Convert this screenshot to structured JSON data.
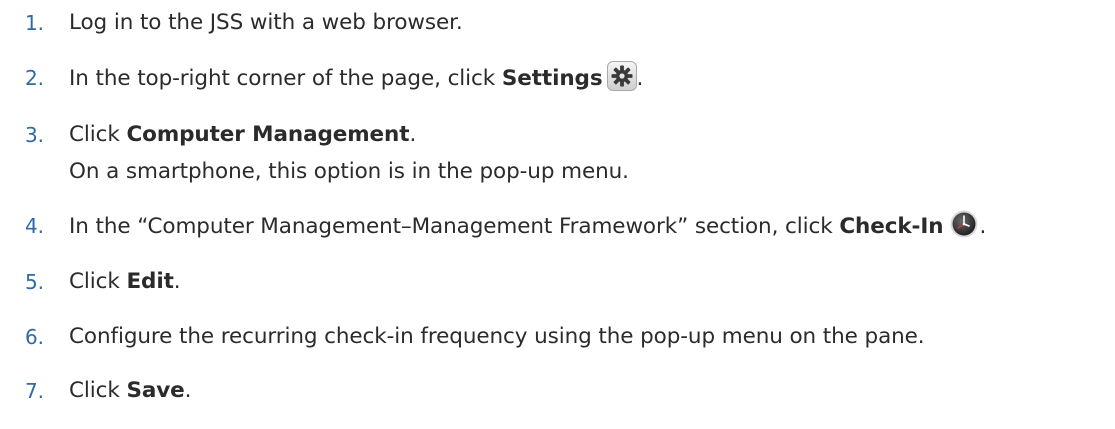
{
  "steps": [
    {
      "num": "1.",
      "parts": {
        "a": "Log in to the JSS with a web browser."
      }
    },
    {
      "num": "2.",
      "parts": {
        "a": "In the top-right corner of the page, click ",
        "b": "Settings",
        "after": "."
      }
    },
    {
      "num": "3.",
      "parts": {
        "a": "Click ",
        "b": "Computer Management",
        "after": "."
      },
      "subline": "On a smartphone, this option is in the pop-up menu."
    },
    {
      "num": "4.",
      "parts": {
        "a": "In the “Computer Management–Management Framework” section, click ",
        "b": "Check-In",
        "after": "."
      }
    },
    {
      "num": "5.",
      "parts": {
        "a": "Click ",
        "b": "Edit",
        "after": "."
      }
    },
    {
      "num": "6.",
      "parts": {
        "a": "Configure the recurring check-in frequency using the pop-up menu on the pane."
      }
    },
    {
      "num": "7.",
      "parts": {
        "a": "Click ",
        "b": "Save",
        "after": "."
      }
    }
  ],
  "icons": {
    "settings": "gear-icon",
    "check_in": "clock-icon"
  },
  "colors": {
    "number": "#2f6aa8",
    "text": "#2b2b2b"
  }
}
